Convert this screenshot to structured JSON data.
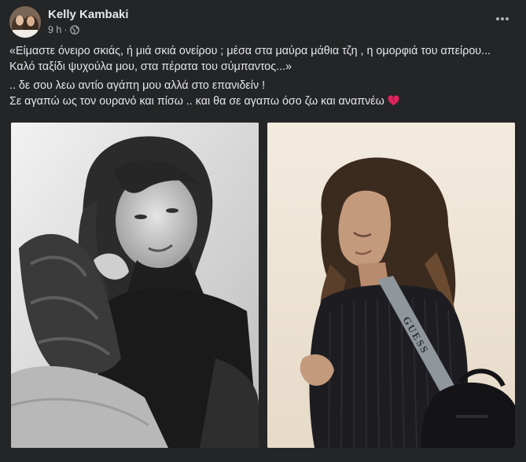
{
  "post": {
    "author": "Kelly Kambaki",
    "time": "9 h",
    "separator": "·",
    "text_lines": [
      "«Είμαστε όνειρο σκιάς, ή μιά σκιά ονείρου ; μέσα στα μαύρα μάθια τζη , η ομορφιά του απείρου... Καλό ταξίδι ψυχούλα μου, στα πέρατα του σύμπαντος...»",
      ".. δε σου λεω αντίο αγάπη μου  αλλά στο επανιδείν !",
      "Σε αγαπώ ως τον ουρανό και πίσω .. και θα σε αγαπω όσο ζω και αναπνέω"
    ],
    "emoji": "broken-heart",
    "bag_strap_text": "GUESS"
  },
  "icons": {
    "globe": "globe-icon",
    "more": "more-horizontal-icon",
    "broken_heart": "broken-heart-icon"
  },
  "colors": {
    "background": "#242526",
    "primary_text": "#e4e6eb",
    "secondary_text": "#b0b3b8",
    "heart": "#e0245e"
  }
}
